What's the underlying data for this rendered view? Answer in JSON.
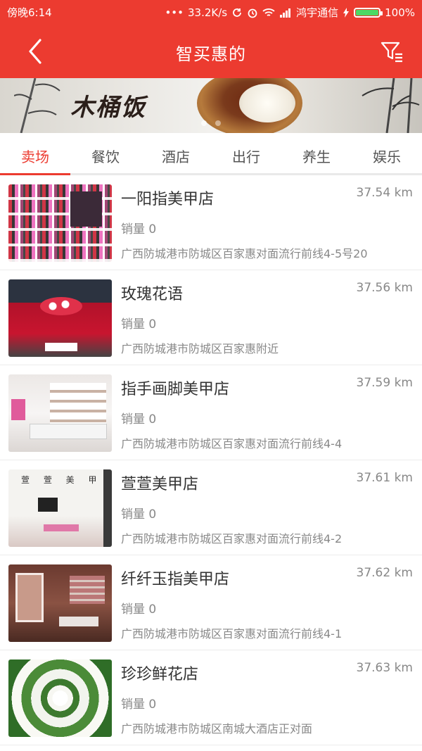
{
  "status_bar": {
    "time": "傍晚6:14",
    "dots": "•••",
    "speed": "33.2K/s",
    "carrier": "鸿宇通信",
    "battery": "100%"
  },
  "header": {
    "title": "智买惠的",
    "back_icon": "chevron-left-icon",
    "filter_icon": "filter-icon"
  },
  "banner": {
    "text": "木桶饭"
  },
  "tabs": [
    {
      "label": "卖场",
      "active": true
    },
    {
      "label": "餐饮",
      "active": false
    },
    {
      "label": "酒店",
      "active": false
    },
    {
      "label": "出行",
      "active": false
    },
    {
      "label": "养生",
      "active": false
    },
    {
      "label": "娱乐",
      "active": false
    }
  ],
  "accent_color": "#ec3b30",
  "stores": [
    {
      "name": "一阳指美甲店",
      "distance": "37.54 km",
      "sales": "销量 0",
      "address": "广西防城港市防城区百家惠对面流行前线4-5号20"
    },
    {
      "name": "玫瑰花语",
      "distance": "37.56 km",
      "sales": "销量 0",
      "address": "广西防城港市防城区百家惠附近"
    },
    {
      "name": "指手画脚美甲店",
      "distance": "37.59 km",
      "sales": "销量 0",
      "address": "广西防城港市防城区百家惠对面流行前线4-4"
    },
    {
      "name": "萱萱美甲店",
      "distance": "37.61 km",
      "sales": "销量 0",
      "address": "广西防城港市防城区百家惠对面流行前线4-2",
      "thumb_sign": "萱 萱 美 甲"
    },
    {
      "name": "纤纤玉指美甲店",
      "distance": "37.62 km",
      "sales": "销量 0",
      "address": "广西防城港市防城区百家惠对面流行前线4-1"
    },
    {
      "name": "珍珍鲜花店",
      "distance": "37.63 km",
      "sales": "销量 0",
      "address": "广西防城港市防城区南城大酒店正对面"
    }
  ]
}
